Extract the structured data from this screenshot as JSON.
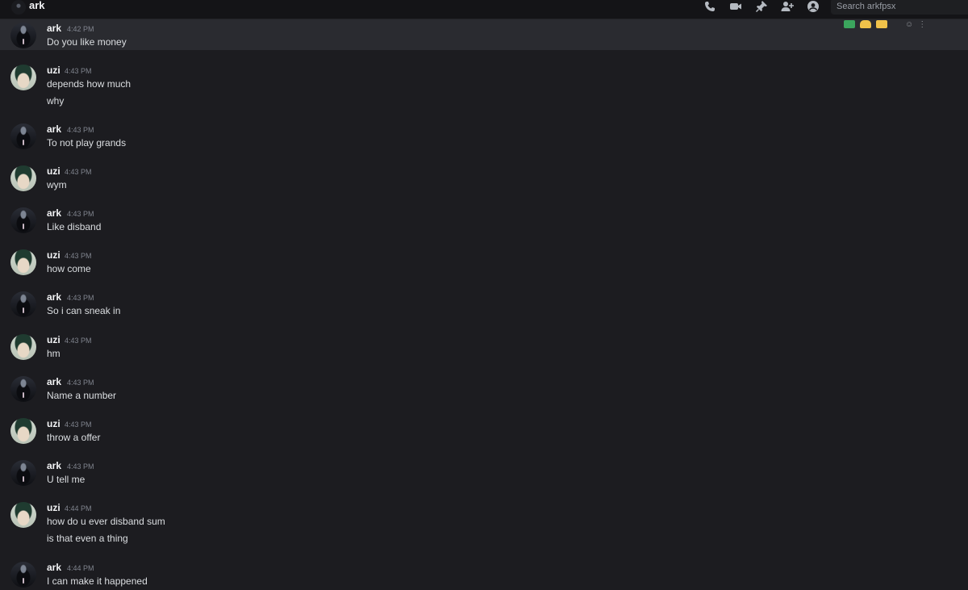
{
  "header": {
    "dm_name": "ark",
    "search_placeholder": "Search arkfpsx",
    "icons": [
      "voice-call-icon",
      "video-call-icon",
      "pin-icon",
      "add-friend-icon",
      "user-profile-icon"
    ]
  },
  "reactions": [
    "check-mark",
    "raised-hand",
    "thumbs-up"
  ],
  "messages": [
    {
      "author": "ark",
      "time": "4:42 PM",
      "lines": [
        "Do you like money"
      ]
    },
    {
      "author": "uzi",
      "time": "4:43 PM",
      "lines": [
        "depends how much",
        "why"
      ]
    },
    {
      "author": "ark",
      "time": "4:43 PM",
      "lines": [
        "To not play grands"
      ]
    },
    {
      "author": "uzi",
      "time": "4:43 PM",
      "lines": [
        "wym"
      ]
    },
    {
      "author": "ark",
      "time": "4:43 PM",
      "lines": [
        "Like disband"
      ]
    },
    {
      "author": "uzi",
      "time": "4:43 PM",
      "lines": [
        "how come"
      ]
    },
    {
      "author": "ark",
      "time": "4:43 PM",
      "lines": [
        "So i can sneak in"
      ]
    },
    {
      "author": "uzi",
      "time": "4:43 PM",
      "lines": [
        "hm"
      ]
    },
    {
      "author": "ark",
      "time": "4:43 PM",
      "lines": [
        "Name a number"
      ]
    },
    {
      "author": "uzi",
      "time": "4:43 PM",
      "lines": [
        "throw a offer"
      ]
    },
    {
      "author": "ark",
      "time": "4:43 PM",
      "lines": [
        "U tell me"
      ]
    },
    {
      "author": "uzi",
      "time": "4:44 PM",
      "lines": [
        "how do u ever disband sum",
        "is that even a thing"
      ]
    },
    {
      "author": "ark",
      "time": "4:44 PM",
      "lines": [
        "I can make it happened"
      ]
    }
  ]
}
